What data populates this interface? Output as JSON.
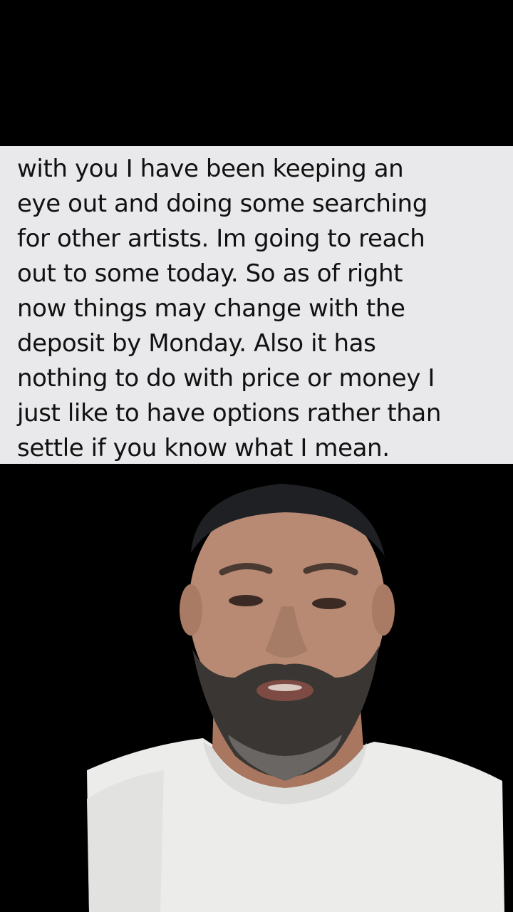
{
  "message": {
    "lines": [
      "with you I have been keeping an",
      "eye out and doing some searching",
      "for other artists. Im going to reach",
      "out to some today. So as of right",
      "now things may change with the",
      "deposit by Monday. Also it has",
      "nothing to do with price or money I",
      "just like to have options rather than",
      "settle if you know what I mean."
    ]
  },
  "colors": {
    "background": "#000000",
    "message_panel": "#e9e9eb",
    "text": "#111111",
    "shirt": "#ececea",
    "skin": "#b88a74",
    "beard": "#3a3633",
    "cap": "#1e2024"
  },
  "scene": {
    "subject": "man-in-white-tshirt-with-beard-and-dark-beanie"
  }
}
